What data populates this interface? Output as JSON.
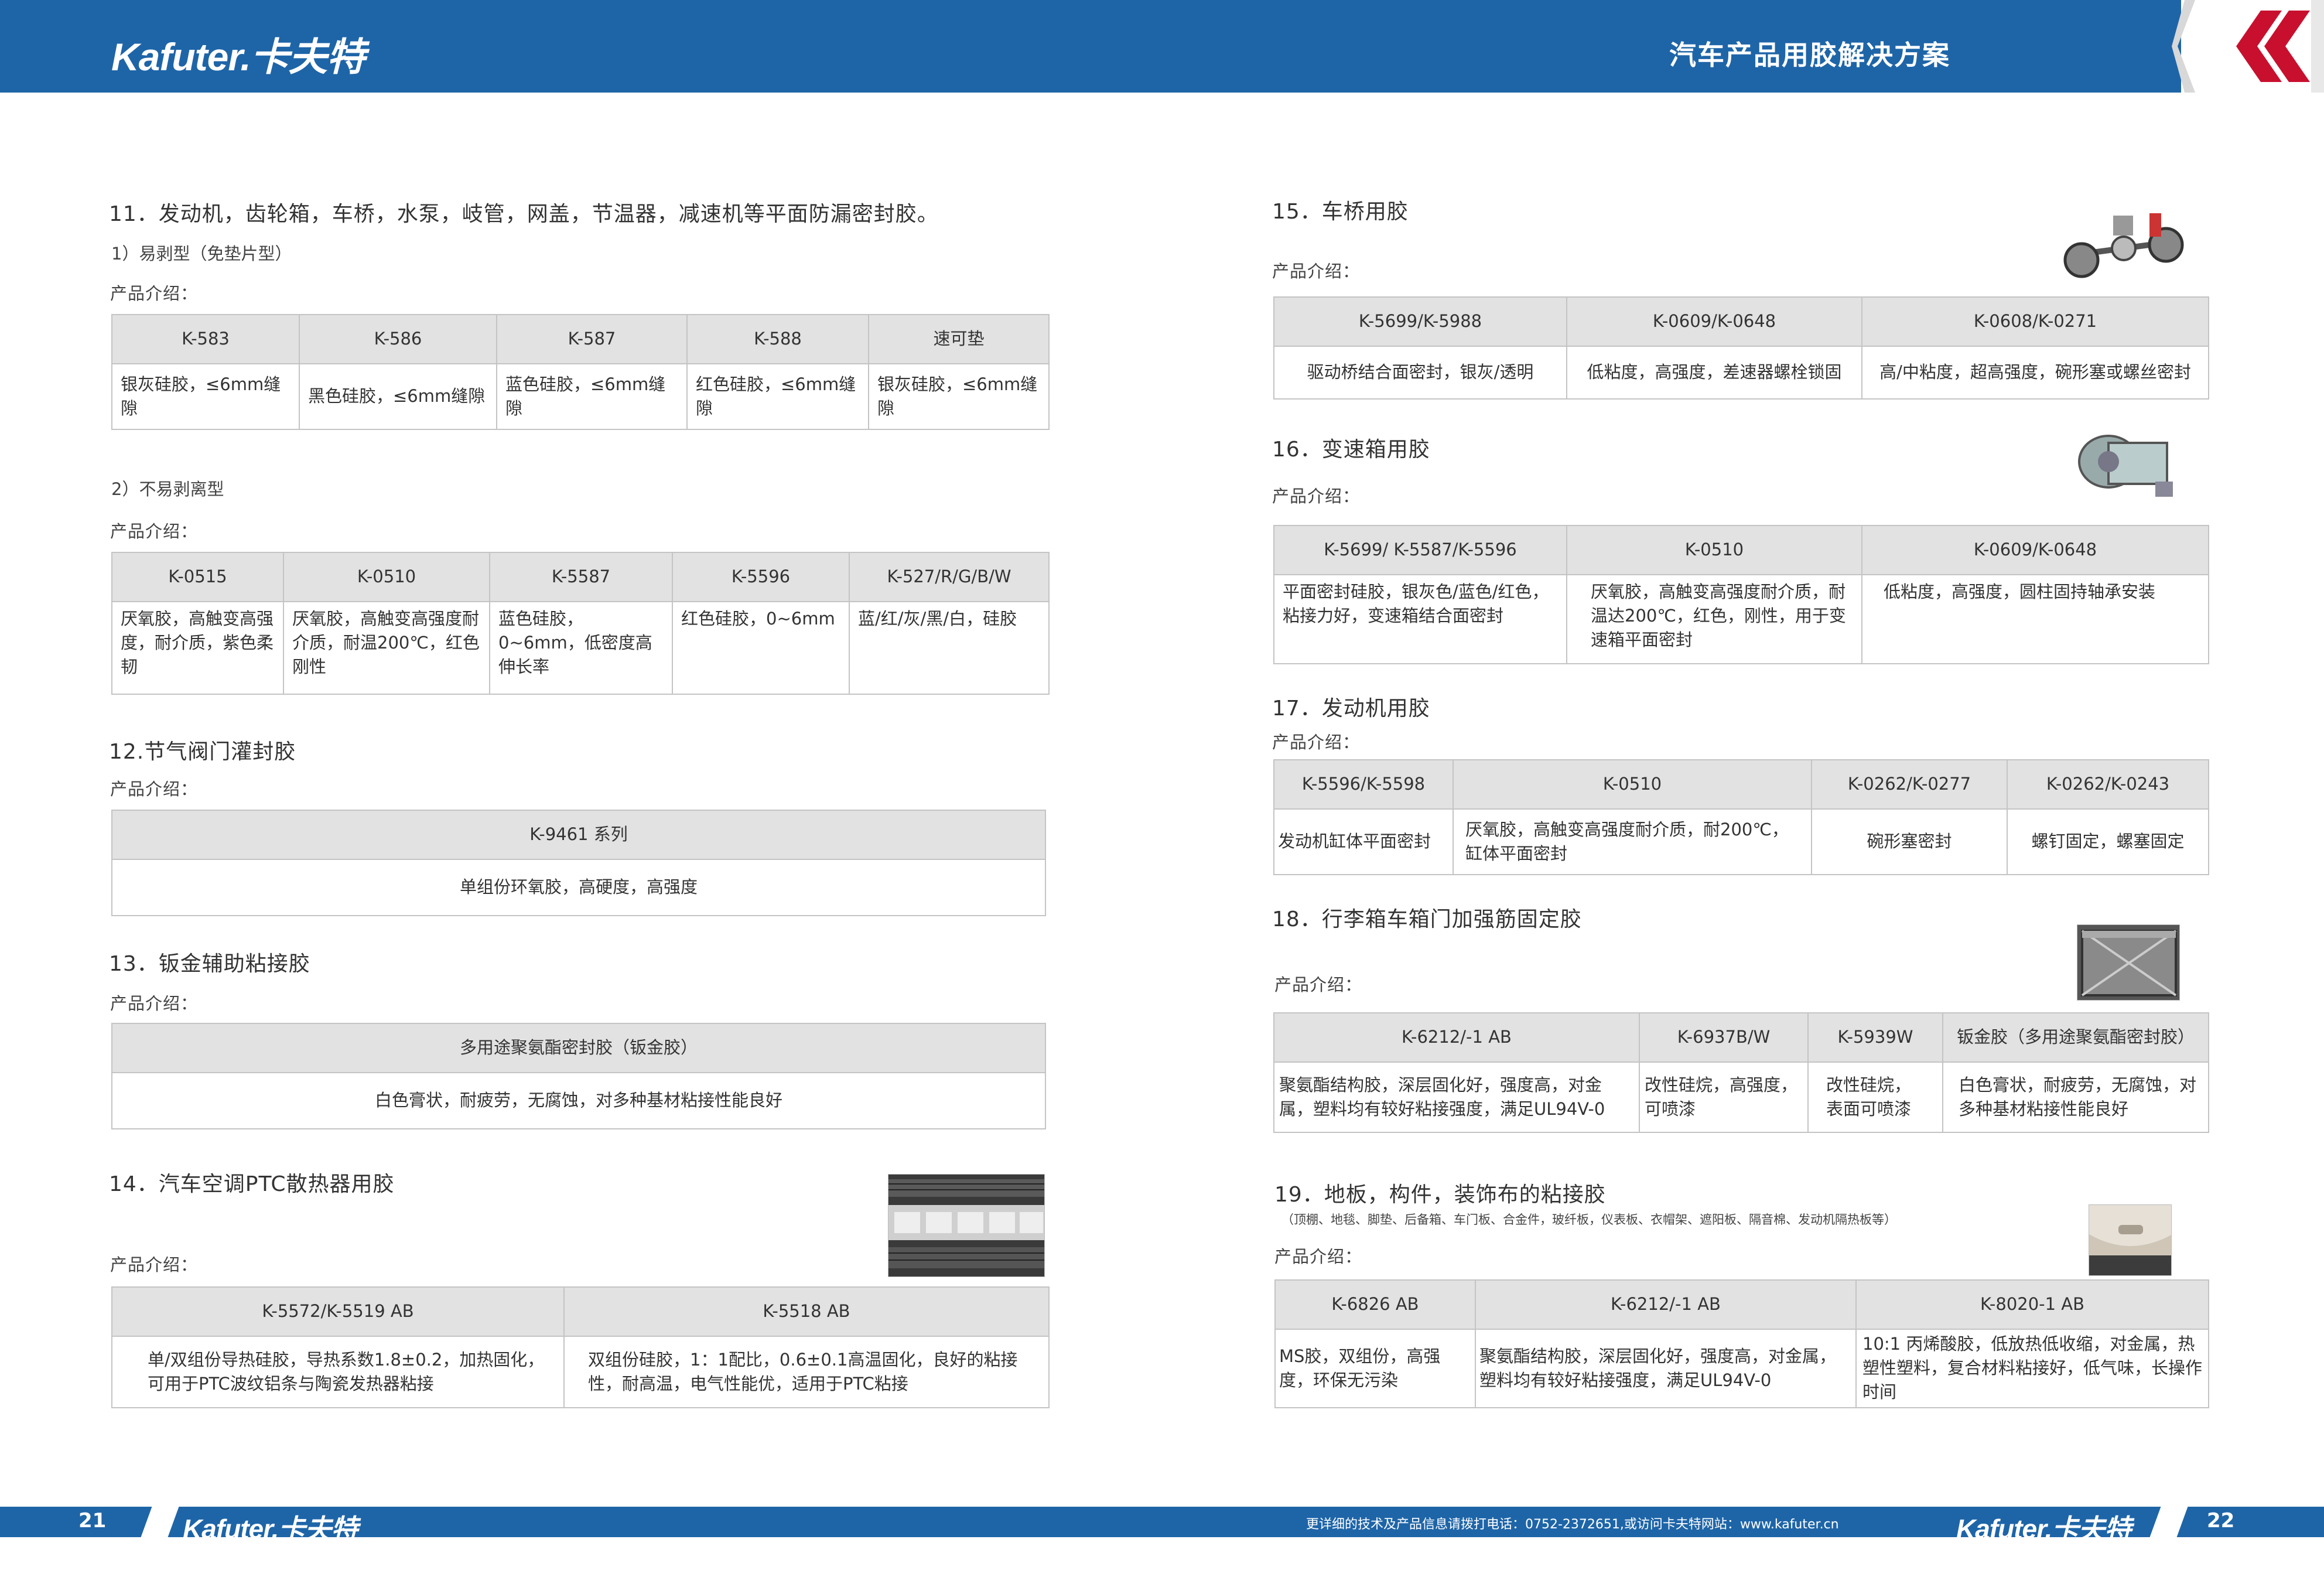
{
  "header": {
    "brand_logo": "Kafuter.卡夫特",
    "title": "汽车产品用胶解决方案"
  },
  "left": {
    "s11": {
      "title": "11．发动机，齿轮箱，车桥，水泵，岐管，网盖，节温器，减速机等平面防漏密封胶。",
      "sub1": "1）易剥型（免垫片型）",
      "label1": "产品介绍：",
      "t1": {
        "headers": [
          "K-583",
          "K-586",
          "K-587",
          "K-588",
          "速可垫"
        ],
        "cells": [
          "银灰硅胶，≤6mm缝隙",
          "黑色硅胶，≤6mm缝隙",
          "蓝色硅胶，≤6mm缝隙",
          "红色硅胶，≤6mm缝隙",
          "银灰硅胶，≤6mm缝隙"
        ]
      },
      "sub2": "2）不易剥离型",
      "label2": "产品介绍：",
      "t2": {
        "headers": [
          "K-0515",
          "K-0510",
          "K-5587",
          "K-5596",
          "K-527/R/G/B/W"
        ],
        "cells": [
          "厌氧胶，高触变高强度，耐介质，紫色柔韧",
          "厌氧胶，高触变高强度耐介质，耐温200℃，红色刚性",
          "蓝色硅胶，0~6mm，低密度高伸长率",
          "红色硅胶，0~6mm",
          "蓝/红/灰/黑/白，硅胶"
        ]
      }
    },
    "s12": {
      "title": "12.节气阀门灌封胶",
      "label": "产品介绍：",
      "header": "K-9461 系列",
      "cell": "单组份环氧胶，高硬度，高强度"
    },
    "s13": {
      "title": "13．钣金辅助粘接胶",
      "label": "产品介绍：",
      "header": "多用途聚氨酯密封胶（钣金胶）",
      "cell": "白色膏状，耐疲劳，无腐蚀，对多种基材粘接性能良好"
    },
    "s14": {
      "title": "14．汽车空调PTC散热器用胶",
      "label": "产品介绍：",
      "headers": [
        "K-5572/K-5519 AB",
        "K-5518 AB"
      ],
      "cells": [
        "单/双组份导热硅胶，导热系数1.8±0.2，加热固化，可用于PTC波纹铝条与陶瓷发热器粘接",
        "双组份硅胶，1：1配比，0.6±0.1高温固化，良好的粘接性，耐高温，电气性能优，适用于PTC粘接"
      ]
    }
  },
  "right": {
    "s15": {
      "title": "15．车桥用胶",
      "label": "产品介绍：",
      "headers": [
        "K-5699/K-5988",
        "K-0609/K-0648",
        "K-0608/K-0271"
      ],
      "cells": [
        "驱动桥结合面密封，银灰/透明",
        "低粘度，高强度，差速器螺栓锁固",
        "高/中粘度，超高强度，碗形塞或螺丝密封"
      ]
    },
    "s16": {
      "title": "16．变速箱用胶",
      "label": "产品介绍：",
      "headers": [
        "K-5699/ K-5587/K-5596",
        "K-0510",
        "K-0609/K-0648"
      ],
      "cells": [
        "平面密封硅胶，银灰色/蓝色/红色，粘接力好，变速箱结合面密封",
        "厌氧胶，高触变高强度耐介质，耐温达200℃，红色，刚性，用于变速箱平面密封",
        "低粘度，高强度，圆柱固持轴承安装"
      ]
    },
    "s17": {
      "title": "17．发动机用胶",
      "label": "产品介绍：",
      "headers": [
        "K-5596/K-5598",
        "K-0510",
        "K-0262/K-0277",
        "K-0262/K-0243"
      ],
      "cells": [
        "发动机缸体平面密封",
        "厌氧胶，高触变高强度耐介质，耐200℃，缸体平面密封",
        "碗形塞密封",
        "螺钉固定，螺塞固定"
      ]
    },
    "s18": {
      "title": "18．行李箱车箱门加强筋固定胶",
      "label": "产品介绍：",
      "headers": [
        "K-6212/-1 AB",
        "K-6937B/W",
        "K-5939W",
        "钣金胶（多用途聚氨酯密封胶）"
      ],
      "cells": [
        "聚氨酯结构胶，深层固化好，强度高，对金属，塑料均有较好粘接强度，满足UL94V-0",
        "改性硅烷，高强度，可喷漆",
        "改性硅烷，表面可喷漆",
        "白色膏状，耐疲劳，无腐蚀，对多种基材粘接性能良好"
      ]
    },
    "s19": {
      "title": "19．地板，构件，装饰布的粘接胶",
      "note": "（顶棚、地毯、脚垫、后备箱、车门板、合金件，玻纤板，仪表板、衣帽架、遮阳板、隔音棉、发动机隔热板等）",
      "label": "产品介绍：",
      "headers": [
        "K-6826 AB",
        "K-6212/-1 AB",
        "K-8020-1 AB"
      ],
      "cells": [
        "MS胶，双组份，高强度，环保无污染",
        "聚氨酯结构胶，深层固化好，强度高，对金属，塑料均有较好粘接强度，满足UL94V-0",
        "10:1 丙烯酸胶，低放热低收缩，对金属，热塑性塑料，复合材料粘接好，低气味，长操作时间"
      ]
    }
  },
  "footer": {
    "page_left": "21",
    "page_right": "22",
    "logo_left": "Kafuter.卡夫特",
    "logo_right": "Kafuter.卡夫特",
    "contact": "更详细的技术及产品信息请拨打电话：0752-2372651,或访问卡夫特网站：www.kafuter.cn"
  },
  "colors": {
    "brand_blue": "#1e65a8",
    "accent_red": "#c8102e",
    "table_header_bg": "#e2e2e2"
  },
  "images": [
    "ptc-heater-photo",
    "axle-assembly-photo",
    "gearbox-photo",
    "trunk-lid-photo",
    "car-headliner-photo"
  ]
}
